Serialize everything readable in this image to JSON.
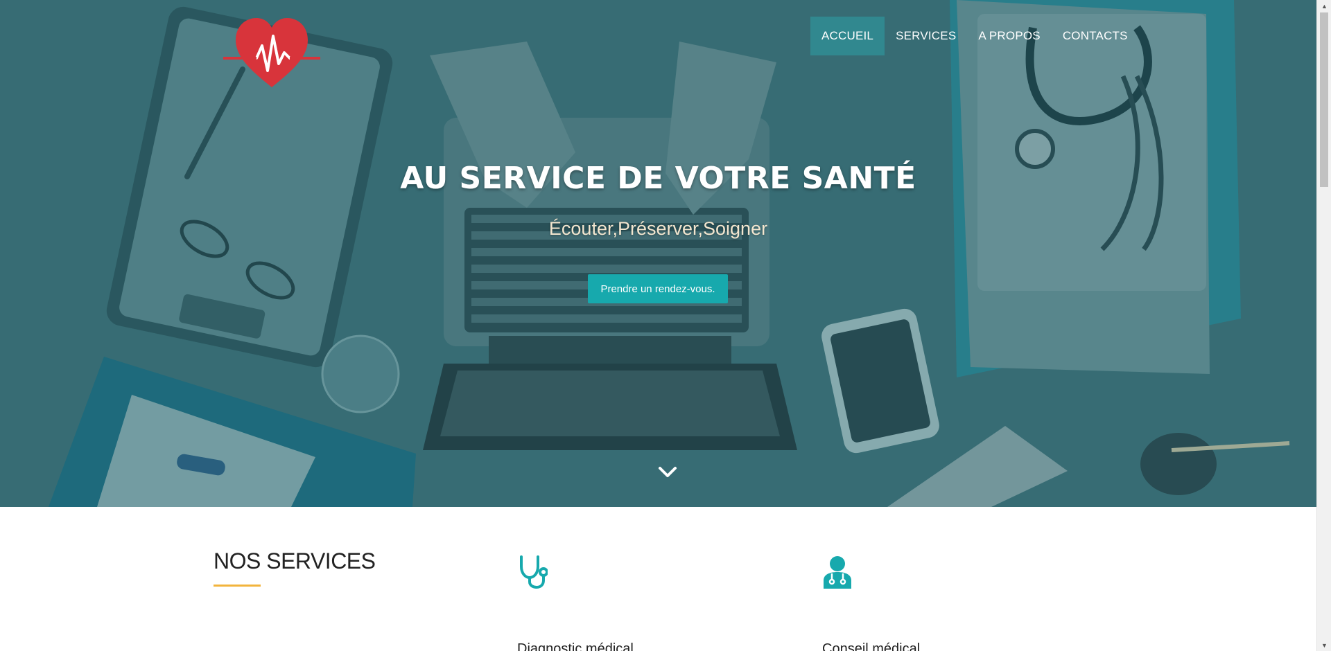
{
  "nav": {
    "items": [
      {
        "label": "ACCUEIL",
        "active": true
      },
      {
        "label": "SERVICES",
        "active": false
      },
      {
        "label": "A PROPOS",
        "active": false
      },
      {
        "label": "CONTACTS",
        "active": false
      }
    ]
  },
  "hero": {
    "title": "AU SERVICE DE VOTRE SANTÉ",
    "subtitle": "Écouter,Préserver,Soigner",
    "cta_label": "Prendre un rendez-vous."
  },
  "services": {
    "title": "NOS SERVICES",
    "items": [
      {
        "name": "Diagnostic médical",
        "icon": "stethoscope-icon"
      },
      {
        "name": "Conseil médical",
        "icon": "doctor-icon"
      }
    ]
  },
  "colors": {
    "accent": "#17a9ad",
    "logo": "#d8343b",
    "underline": "#f2b43c",
    "hero_overlay": "#3a6a72"
  }
}
